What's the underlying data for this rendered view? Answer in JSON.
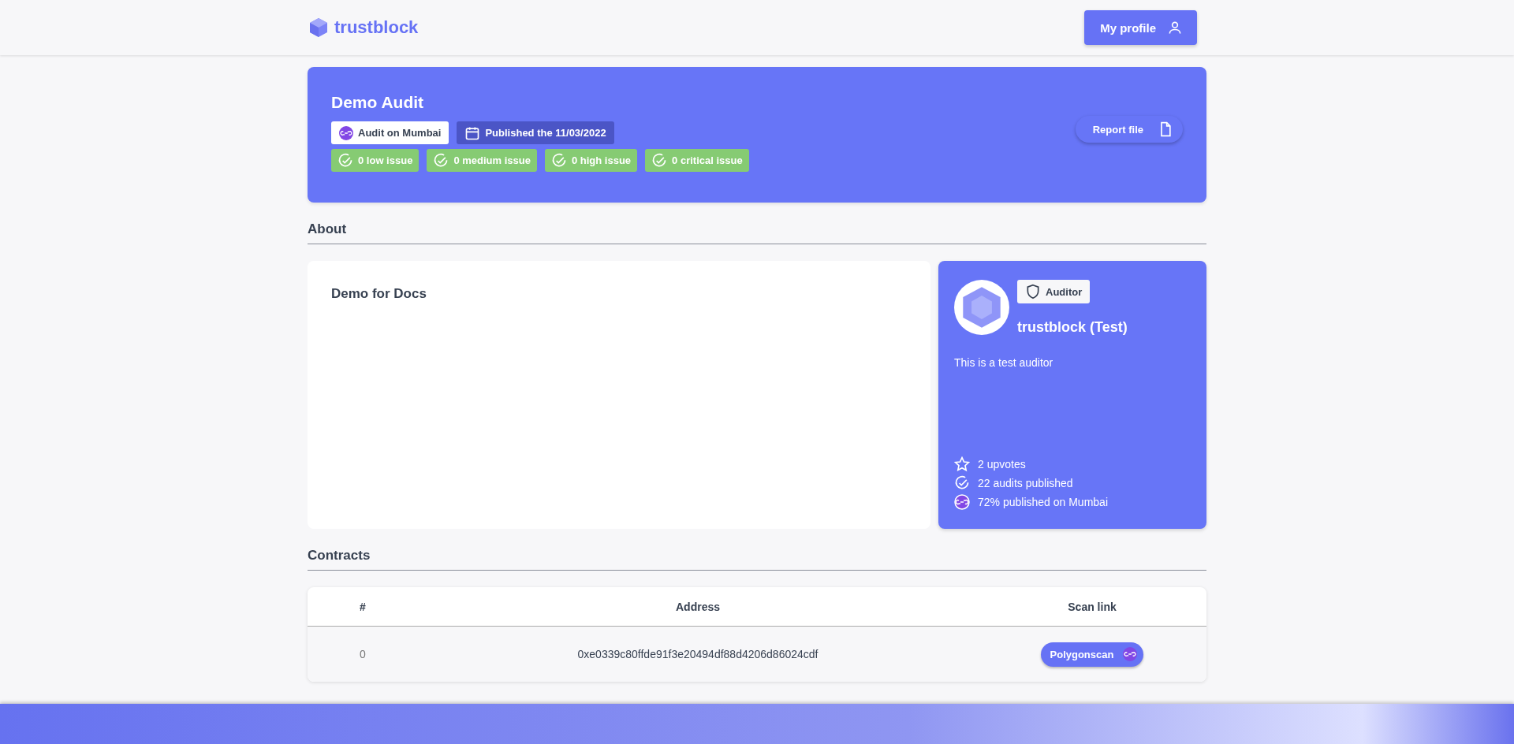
{
  "header": {
    "logo": "trustblock",
    "profile_button": "My profile"
  },
  "audit": {
    "title": "Demo Audit",
    "chain": "Audit on Mumbai",
    "published": "Published the 11/03/2022",
    "issues": [
      "0 low issue",
      "0 medium issue",
      "0 high issue",
      "0 critical issue"
    ],
    "report_button": "Report file"
  },
  "about": {
    "heading": "About",
    "description": "Demo for Docs"
  },
  "auditor": {
    "badge": "Auditor",
    "name": "trustblock (Test)",
    "bio": "This is a test auditor",
    "stats": [
      {
        "kind": "star",
        "text": "2 upvotes"
      },
      {
        "kind": "check",
        "text": "22 audits published"
      },
      {
        "kind": "chain",
        "text": "72% published on Mumbai"
      }
    ]
  },
  "contracts": {
    "heading": "Contracts",
    "columns": [
      "#",
      "Address",
      "Scan link"
    ],
    "rows": [
      {
        "index": "0",
        "address": "0xe0339c80ffde91f3e20494df88d4206d86024cdf",
        "link": "Polygonscan"
      }
    ]
  }
}
